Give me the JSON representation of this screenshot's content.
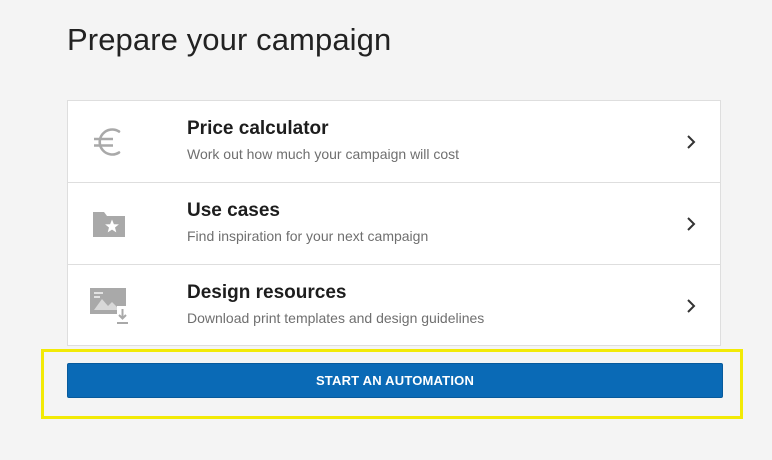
{
  "page": {
    "title": "Prepare your campaign"
  },
  "cards": [
    {
      "title": "Price calculator",
      "description": "Work out how much your campaign will cost",
      "icon": "euro-icon"
    },
    {
      "title": "Use cases",
      "description": "Find inspiration for your next campaign",
      "icon": "folder-star-icon"
    },
    {
      "title": "Design resources",
      "description": "Download print templates and design guidelines",
      "icon": "image-download-icon"
    }
  ],
  "cta": {
    "label": "START AN AUTOMATION"
  },
  "colors": {
    "background": "#f4f4f4",
    "card_background": "#ffffff",
    "border": "#dedede",
    "icon_gray": "#a9a9a9",
    "button_blue": "#0a6ab6",
    "highlight_yellow": "#f2ea06"
  }
}
